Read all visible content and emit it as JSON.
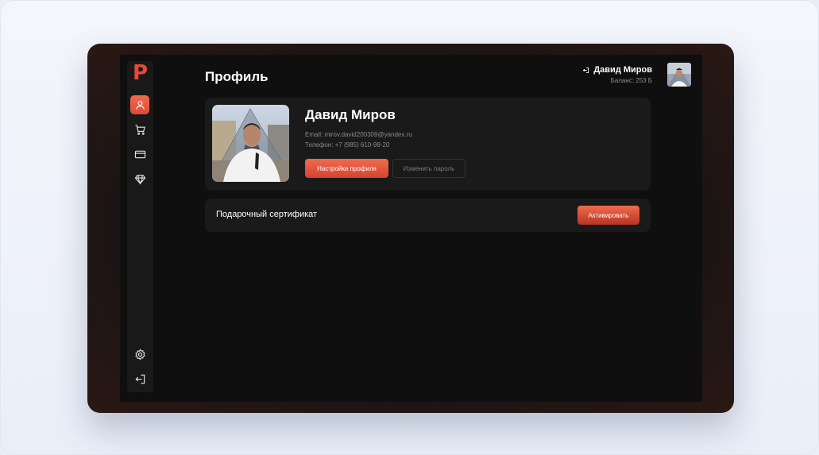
{
  "app": {
    "logo_letter": "P"
  },
  "header": {
    "title": "Профиль",
    "user_name": "Давид Миров",
    "balance": "Баланс: 253 Б"
  },
  "sidebar": {
    "items": [
      {
        "name": "profile",
        "icon": "user-icon",
        "active": true
      },
      {
        "name": "cart",
        "icon": "cart-icon",
        "active": false
      },
      {
        "name": "cards",
        "icon": "credit-card-icon",
        "active": false
      },
      {
        "name": "premium",
        "icon": "diamond-icon",
        "active": false
      }
    ],
    "bottom": [
      {
        "name": "settings",
        "icon": "gear-icon"
      },
      {
        "name": "logout",
        "icon": "logout-icon"
      }
    ]
  },
  "profile": {
    "name": "Давид Миров",
    "email": "Email: mirov.david200309@yandex.ru",
    "phone": "Телефон: +7 (985) 610-98-20",
    "settings_button": "Настройки профиля",
    "password_button": "Изменить пароль"
  },
  "certificate": {
    "label": "Подарочный сертификат",
    "activate_button": "Активировать"
  },
  "colors": {
    "accent": "#e8493a",
    "background": "#0f0f0f",
    "card": "#1a1a1a"
  }
}
